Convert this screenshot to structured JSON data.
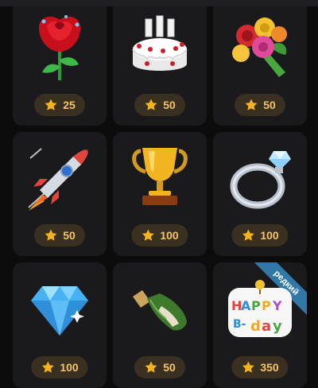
{
  "gifts": [
    {
      "name": "rose",
      "price": "25"
    },
    {
      "name": "birthday-cake",
      "price": "50"
    },
    {
      "name": "bouquet",
      "price": "50"
    },
    {
      "name": "rocket",
      "price": "50"
    },
    {
      "name": "trophy",
      "price": "100"
    },
    {
      "name": "diamond-ring",
      "price": "100"
    },
    {
      "name": "diamond",
      "price": "100"
    },
    {
      "name": "champagne",
      "price": "50"
    },
    {
      "name": "happy-birthday-sticker",
      "price": "350",
      "badge": "редкий"
    }
  ],
  "icons": {
    "price": "star-icon"
  },
  "colors": {
    "background": "#0c0c0d",
    "card": "#1a1a1c",
    "price_pill": "#3a3022",
    "price_text": "#f3c46a",
    "badge": "#2f78a8"
  }
}
